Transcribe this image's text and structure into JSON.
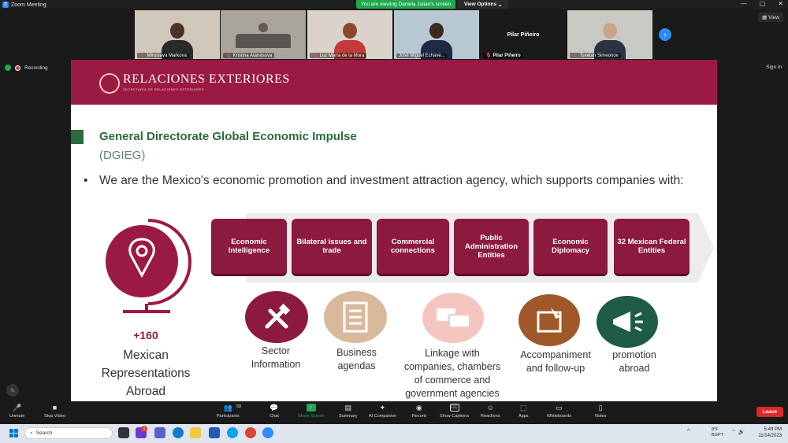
{
  "window": {
    "title": "Zoom Meeting",
    "viewing_banner": "You are viewing Daniela Julian's screen",
    "view_options": "View Options",
    "view_button": "View",
    "sign_in": "Sign in"
  },
  "recording": {
    "label": "Recording"
  },
  "participants_strip": [
    {
      "name": "Miroslava Markova"
    },
    {
      "name": "Kristina Atanasova"
    },
    {
      "name": "Luz María de la Mora"
    },
    {
      "name": "José Miguel Echave..."
    },
    {
      "name": "Pilar Piñeiro",
      "display_name": "Pilar Piñeiro"
    },
    {
      "name": "Tsvetan Simeonov"
    }
  ],
  "slide": {
    "brand": "RELACIONES EXTERIORES",
    "brand_sub": "SECRETARÍA DE RELACIONES EXTERIORES",
    "title": "General Directorate Global Economic Impulse",
    "subtitle": "(DGIEG)",
    "bullet": "We are the Mexico's economic promotion and investment attraction agency, which supports companies with:",
    "representations": {
      "count": "+160",
      "label_line1": "Mexican",
      "label_line2": "Representations",
      "label_line3": "Abroad"
    },
    "boxes": [
      {
        "label": "Economic Intelligence"
      },
      {
        "label": "Bilateral issues and trade"
      },
      {
        "label": "Commercial connections"
      },
      {
        "label": "Public Administration Entities"
      },
      {
        "label": "Economic Diplomacy"
      },
      {
        "label": "32 Mexican Federal Entities"
      }
    ],
    "services": [
      {
        "line1": "Sector",
        "line2": "Information",
        "icon": "tools-icon",
        "color": "#8c1a3f"
      },
      {
        "line1": "Business",
        "line2": "agendas",
        "icon": "document-icon",
        "color": "#d9b99b"
      },
      {
        "line1": "Linkage with",
        "line2": "companies, chambers",
        "line3": "of commerce and",
        "line4": "government agencies",
        "icon": "chat-icon",
        "color": "#f4c6bf"
      },
      {
        "line1": "Accompaniment",
        "line2": "and follow-up",
        "icon": "notes-icon",
        "color": "#a0582a"
      },
      {
        "line1": "promotion",
        "line2": "abroad",
        "icon": "megaphone-icon",
        "color": "#1e5c47"
      }
    ]
  },
  "toolbar": {
    "unmute": "Unmute",
    "stop_video": "Stop Video",
    "participants": "Participants",
    "participants_count": "58",
    "chat": "Chat",
    "share_screen": "Share Screen",
    "summary": "Summary",
    "ai_companion": "AI Companion",
    "record": "Record",
    "show_captions": "Show Captions",
    "reactions": "Reactions",
    "apps": "Apps",
    "whiteboards": "Whiteboards",
    "notes": "Notes",
    "leave": "Leave"
  },
  "taskbar": {
    "search_placeholder": "Search",
    "time": "5:49 PM",
    "date": "11/14/2023",
    "weather_temp": "8°F",
    "weather_label": "BGPT",
    "chat_badge": "1"
  },
  "colors": {
    "slide_brand": "#9b1a43",
    "box": "#8c1a3f",
    "title_green": "#2a6b3c",
    "share_green": "#1fa94f",
    "leave_red": "#e02828"
  }
}
